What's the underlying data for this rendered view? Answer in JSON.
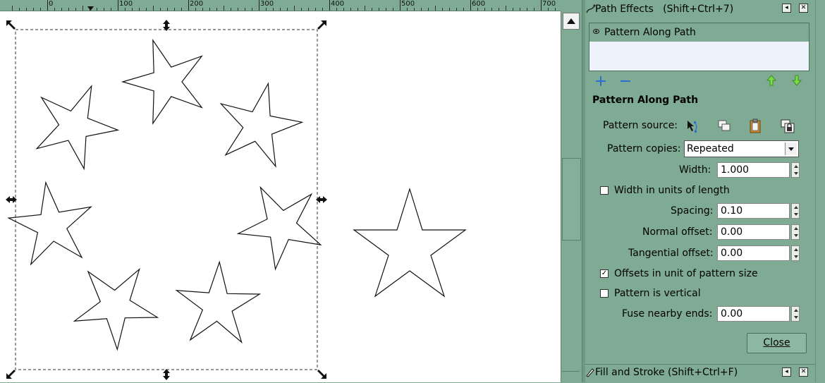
{
  "ruler": {
    "labels": [
      "0",
      "100",
      "200",
      "300",
      "400",
      "500",
      "600",
      "700"
    ]
  },
  "path_effects": {
    "title": "Path Effects   (Shift+Ctrl+7)",
    "effects": [
      {
        "label": "Pattern Along Path",
        "visible": true
      }
    ],
    "section_title": "Pattern Along Path",
    "pattern_source_label": "Pattern source:",
    "pattern_source_tools": [
      "edit-on-canvas-icon",
      "copy-icon",
      "paste-icon",
      "link-to-path-icon"
    ],
    "pattern_copies_label": "Pattern copies:",
    "pattern_copies_value": "Repeated",
    "width_label": "Width:",
    "width_value": "1.000",
    "width_units_label": "Width in units of length",
    "width_units_checked": false,
    "spacing_label": "Spacing:",
    "spacing_value": "0.10",
    "normal_offset_label": "Normal offset:",
    "normal_offset_value": "0.00",
    "tangential_offset_label": "Tangential offset:",
    "tangential_offset_value": "0.00",
    "offsets_unit_label": "Offsets in unit of pattern size",
    "offsets_unit_checked": true,
    "vertical_label": "Pattern is vertical",
    "vertical_checked": false,
    "fuse_label": "Fuse nearby ends:",
    "fuse_value": "0.00",
    "close_label": "Close"
  },
  "fill_stroke": {
    "title": "Fill and Stroke (Shift+Ctrl+F)"
  },
  "colors": {
    "panel_bg": "#7fab94",
    "canvas_bg": "#ffffff",
    "list_bg": "#eef3fb",
    "add_icon": "#2a6fd4",
    "arrow_icon": "#4caf2b"
  }
}
